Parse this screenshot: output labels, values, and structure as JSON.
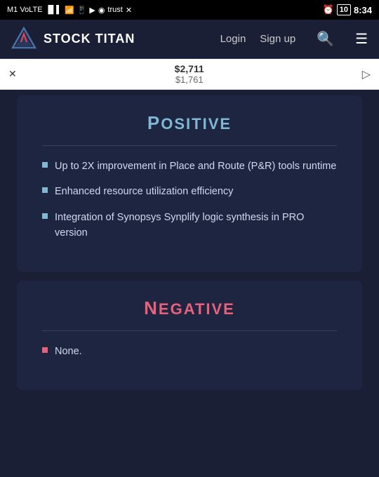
{
  "statusBar": {
    "left": "M1 VoLTE",
    "time": "8:34",
    "battery": "10"
  },
  "navbar": {
    "logoText": "STOCK TITAN",
    "loginLabel": "Login",
    "signupLabel": "Sign up"
  },
  "adBanner": {
    "price1": "$2,711",
    "price2": "$1,761"
  },
  "positive": {
    "title": "Positive",
    "bullets": [
      "Up to 2X improvement in Place and Route (P&R) tools runtime",
      "Enhanced resource utilization efficiency",
      "Integration of Synopsys Synplify logic synthesis in PRO version"
    ]
  },
  "negative": {
    "title": "Negative",
    "bullets": [
      "None."
    ]
  }
}
